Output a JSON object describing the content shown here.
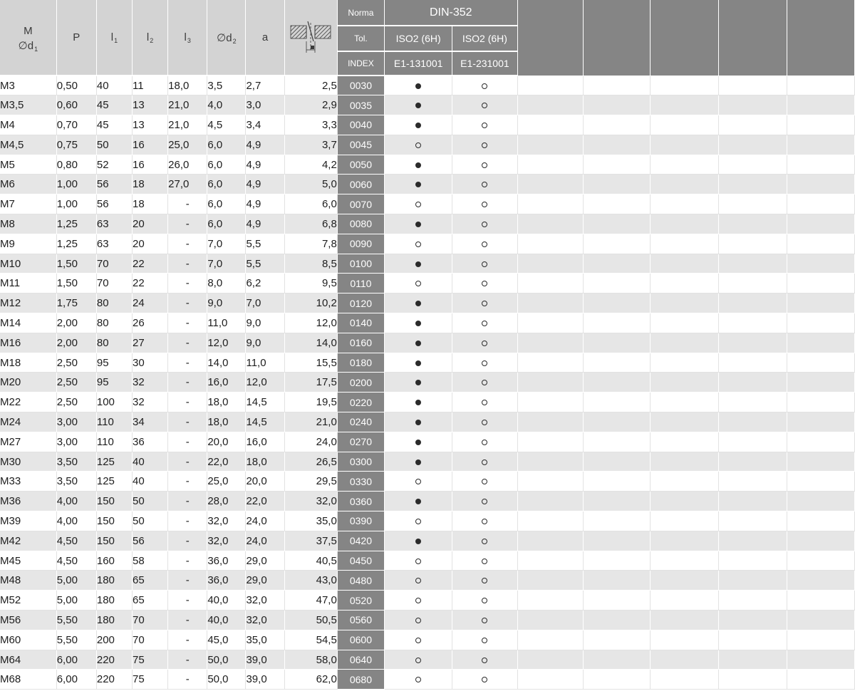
{
  "header": {
    "m_label": "M",
    "d1_symbol": "∅d",
    "d1_sub": "1",
    "p_label": "P",
    "l1_label": "l",
    "l1_sub": "1",
    "l2_label": "l",
    "l2_sub": "2",
    "l3_label": "l",
    "l3_sub": "3",
    "d2_label": "∅d",
    "d2_sub": "2",
    "a_label": "a",
    "symbol_icon": "tap-in-hole-diagram-icon",
    "norma_label": "Norma",
    "norma_value": "DIN-352",
    "tol_label": "Tol.",
    "tol_values": [
      "ISO2 (6H)",
      "ISO2 (6H)"
    ],
    "index_label": "INDEX",
    "index_values": [
      "E1-131001",
      "E1-231001"
    ]
  },
  "rows": [
    {
      "m": "M3",
      "p": "0,50",
      "l1": "40",
      "l2": "11",
      "l3": "18,0",
      "d2": "3,5",
      "a": "2,7",
      "x": "2,5",
      "idx": "0030",
      "s1": "full",
      "s2": "open"
    },
    {
      "m": "M3,5",
      "p": "0,60",
      "l1": "45",
      "l2": "13",
      "l3": "21,0",
      "d2": "4,0",
      "a": "3,0",
      "x": "2,9",
      "idx": "0035",
      "s1": "full",
      "s2": "open"
    },
    {
      "m": "M4",
      "p": "0,70",
      "l1": "45",
      "l2": "13",
      "l3": "21,0",
      "d2": "4,5",
      "a": "3,4",
      "x": "3,3",
      "idx": "0040",
      "s1": "full",
      "s2": "open"
    },
    {
      "m": "M4,5",
      "p": "0,75",
      "l1": "50",
      "l2": "16",
      "l3": "25,0",
      "d2": "6,0",
      "a": "4,9",
      "x": "3,7",
      "idx": "0045",
      "s1": "open",
      "s2": "open"
    },
    {
      "m": "M5",
      "p": "0,80",
      "l1": "52",
      "l2": "16",
      "l3": "26,0",
      "d2": "6,0",
      "a": "4,9",
      "x": "4,2",
      "idx": "0050",
      "s1": "full",
      "s2": "open"
    },
    {
      "m": "M6",
      "p": "1,00",
      "l1": "56",
      "l2": "18",
      "l3": "27,0",
      "d2": "6,0",
      "a": "4,9",
      "x": "5,0",
      "idx": "0060",
      "s1": "full",
      "s2": "open"
    },
    {
      "m": "M7",
      "p": "1,00",
      "l1": "56",
      "l2": "18",
      "l3": "-",
      "d2": "6,0",
      "a": "4,9",
      "x": "6,0",
      "idx": "0070",
      "s1": "open",
      "s2": "open"
    },
    {
      "m": "M8",
      "p": "1,25",
      "l1": "63",
      "l2": "20",
      "l3": "-",
      "d2": "6,0",
      "a": "4,9",
      "x": "6,8",
      "idx": "0080",
      "s1": "full",
      "s2": "open"
    },
    {
      "m": "M9",
      "p": "1,25",
      "l1": "63",
      "l2": "20",
      "l3": "-",
      "d2": "7,0",
      "a": "5,5",
      "x": "7,8",
      "idx": "0090",
      "s1": "open",
      "s2": "open"
    },
    {
      "m": "M10",
      "p": "1,50",
      "l1": "70",
      "l2": "22",
      "l3": "-",
      "d2": "7,0",
      "a": "5,5",
      "x": "8,5",
      "idx": "0100",
      "s1": "full",
      "s2": "open"
    },
    {
      "m": "M11",
      "p": "1,50",
      "l1": "70",
      "l2": "22",
      "l3": "-",
      "d2": "8,0",
      "a": "6,2",
      "x": "9,5",
      "idx": "0110",
      "s1": "open",
      "s2": "open"
    },
    {
      "m": "M12",
      "p": "1,75",
      "l1": "80",
      "l2": "24",
      "l3": "-",
      "d2": "9,0",
      "a": "7,0",
      "x": "10,2",
      "idx": "0120",
      "s1": "full",
      "s2": "open"
    },
    {
      "m": "M14",
      "p": "2,00",
      "l1": "80",
      "l2": "26",
      "l3": "-",
      "d2": "11,0",
      "a": "9,0",
      "x": "12,0",
      "idx": "0140",
      "s1": "full",
      "s2": "open"
    },
    {
      "m": "M16",
      "p": "2,00",
      "l1": "80",
      "l2": "27",
      "l3": "-",
      "d2": "12,0",
      "a": "9,0",
      "x": "14,0",
      "idx": "0160",
      "s1": "full",
      "s2": "open"
    },
    {
      "m": "M18",
      "p": "2,50",
      "l1": "95",
      "l2": "30",
      "l3": "-",
      "d2": "14,0",
      "a": "11,0",
      "x": "15,5",
      "idx": "0180",
      "s1": "full",
      "s2": "open"
    },
    {
      "m": "M20",
      "p": "2,50",
      "l1": "95",
      "l2": "32",
      "l3": "-",
      "d2": "16,0",
      "a": "12,0",
      "x": "17,5",
      "idx": "0200",
      "s1": "full",
      "s2": "open"
    },
    {
      "m": "M22",
      "p": "2,50",
      "l1": "100",
      "l2": "32",
      "l3": "-",
      "d2": "18,0",
      "a": "14,5",
      "x": "19,5",
      "idx": "0220",
      "s1": "full",
      "s2": "open"
    },
    {
      "m": "M24",
      "p": "3,00",
      "l1": "110",
      "l2": "34",
      "l3": "-",
      "d2": "18,0",
      "a": "14,5",
      "x": "21,0",
      "idx": "0240",
      "s1": "full",
      "s2": "open"
    },
    {
      "m": "M27",
      "p": "3,00",
      "l1": "110",
      "l2": "36",
      "l3": "-",
      "d2": "20,0",
      "a": "16,0",
      "x": "24,0",
      "idx": "0270",
      "s1": "full",
      "s2": "open"
    },
    {
      "m": "M30",
      "p": "3,50",
      "l1": "125",
      "l2": "40",
      "l3": "-",
      "d2": "22,0",
      "a": "18,0",
      "x": "26,5",
      "idx": "0300",
      "s1": "full",
      "s2": "open"
    },
    {
      "m": "M33",
      "p": "3,50",
      "l1": "125",
      "l2": "40",
      "l3": "-",
      "d2": "25,0",
      "a": "20,0",
      "x": "29,5",
      "idx": "0330",
      "s1": "open",
      "s2": "open"
    },
    {
      "m": "M36",
      "p": "4,00",
      "l1": "150",
      "l2": "50",
      "l3": "-",
      "d2": "28,0",
      "a": "22,0",
      "x": "32,0",
      "idx": "0360",
      "s1": "full",
      "s2": "open"
    },
    {
      "m": "M39",
      "p": "4,00",
      "l1": "150",
      "l2": "50",
      "l3": "-",
      "d2": "32,0",
      "a": "24,0",
      "x": "35,0",
      "idx": "0390",
      "s1": "open",
      "s2": "open"
    },
    {
      "m": "M42",
      "p": "4,50",
      "l1": "150",
      "l2": "56",
      "l3": "-",
      "d2": "32,0",
      "a": "24,0",
      "x": "37,5",
      "idx": "0420",
      "s1": "full",
      "s2": "open"
    },
    {
      "m": "M45",
      "p": "4,50",
      "l1": "160",
      "l2": "58",
      "l3": "-",
      "d2": "36,0",
      "a": "29,0",
      "x": "40,5",
      "idx": "0450",
      "s1": "open",
      "s2": "open"
    },
    {
      "m": "M48",
      "p": "5,00",
      "l1": "180",
      "l2": "65",
      "l3": "-",
      "d2": "36,0",
      "a": "29,0",
      "x": "43,0",
      "idx": "0480",
      "s1": "open",
      "s2": "open"
    },
    {
      "m": "M52",
      "p": "5,00",
      "l1": "180",
      "l2": "65",
      "l3": "-",
      "d2": "40,0",
      "a": "32,0",
      "x": "47,0",
      "idx": "0520",
      "s1": "open",
      "s2": "open"
    },
    {
      "m": "M56",
      "p": "5,50",
      "l1": "180",
      "l2": "70",
      "l3": "-",
      "d2": "40,0",
      "a": "32,0",
      "x": "50,5",
      "idx": "0560",
      "s1": "open",
      "s2": "open"
    },
    {
      "m": "M60",
      "p": "5,50",
      "l1": "200",
      "l2": "70",
      "l3": "-",
      "d2": "45,0",
      "a": "35,0",
      "x": "54,5",
      "idx": "0600",
      "s1": "open",
      "s2": "open"
    },
    {
      "m": "M64",
      "p": "6,00",
      "l1": "220",
      "l2": "75",
      "l3": "-",
      "d2": "50,0",
      "a": "39,0",
      "x": "58,0",
      "idx": "0640",
      "s1": "open",
      "s2": "open"
    },
    {
      "m": "M68",
      "p": "6,00",
      "l1": "220",
      "l2": "75",
      "l3": "-",
      "d2": "50,0",
      "a": "39,0",
      "x": "62,0",
      "idx": "0680",
      "s1": "open",
      "s2": "open"
    }
  ]
}
